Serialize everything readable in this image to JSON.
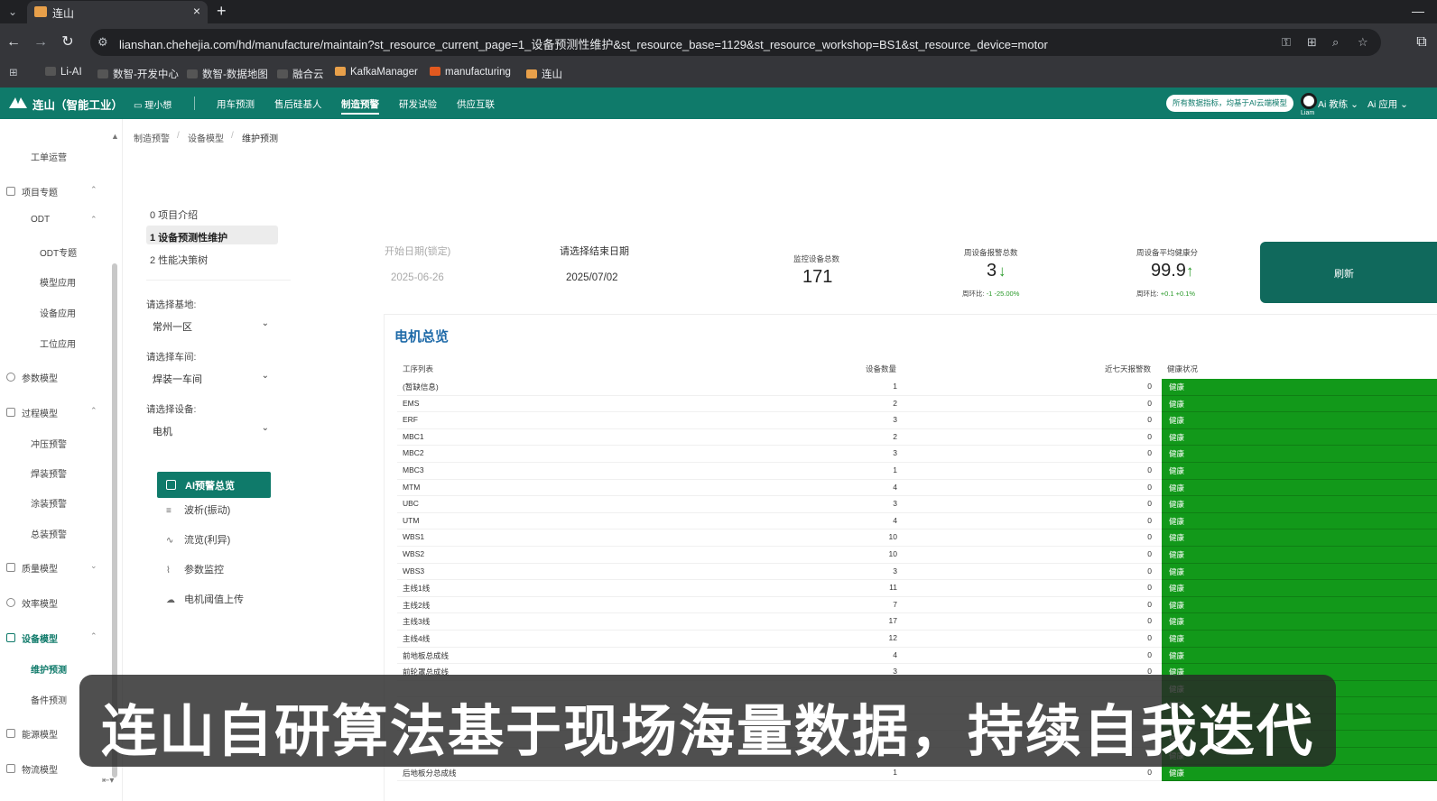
{
  "browser": {
    "tab_title": "连山",
    "url": "lianshan.chehejia.com/hd/manufacture/maintain?st_resource_current_page=1_设备预测性维护&st_resource_base=1129&st_resource_workshop=BS1&st_resource_device=motor",
    "bookmarks": [
      "Li-AI",
      "数智-开发中心",
      "数智-数据地图",
      "融合云",
      "KafkaManager",
      "manufacturing",
      "连山"
    ]
  },
  "app": {
    "name": "连山（智能工业）",
    "mini_program": "理小想",
    "nav": [
      "用车预测",
      "售后硅基人",
      "制造预警",
      "研发试验",
      "供应互联"
    ],
    "active_nav": "制造预警",
    "banner": "所有数据指标，均基于AI云端模型",
    "avatar_label": "Liam",
    "menus": [
      "Ai 教练",
      "Ai 应用"
    ]
  },
  "sidebar": {
    "items": [
      {
        "label": "工单运营"
      },
      {
        "label": "项目专题"
      },
      {
        "label": "ODT"
      },
      {
        "label": "ODT专题"
      },
      {
        "label": "模型应用"
      },
      {
        "label": "设备应用"
      },
      {
        "label": "工位应用"
      },
      {
        "label": "参数模型"
      },
      {
        "label": "过程模型"
      },
      {
        "label": "冲压预警"
      },
      {
        "label": "焊装预警"
      },
      {
        "label": "涂装预警"
      },
      {
        "label": "总装预警"
      },
      {
        "label": "质量模型"
      },
      {
        "label": "效率模型"
      },
      {
        "label": "设备模型"
      },
      {
        "label": "维护预测"
      },
      {
        "label": "备件预测"
      },
      {
        "label": "能源模型"
      },
      {
        "label": "物流模型"
      }
    ]
  },
  "breadcrumb": [
    "制造预警",
    "设备模型",
    "维护预测"
  ],
  "subnav": [
    "0 项目介绍",
    "1 设备预测性维护",
    "2 性能决策树"
  ],
  "filters": {
    "base_label": "请选择基地:",
    "base_value": "常州一区",
    "workshop_label": "请选择车间:",
    "workshop_value": "焊装一车间",
    "device_label": "请选择设备:",
    "device_value": "电机"
  },
  "menu": {
    "active": "AI预警总览",
    "items": [
      "波析(振动)",
      "流览(利异)",
      "参数监控",
      "电机阈值上传"
    ]
  },
  "dates": {
    "start_label": "开始日期(锁定)",
    "start_value": "2025-06-26",
    "end_label": "请选择结束日期",
    "end_value": "2025/07/02"
  },
  "stats": {
    "monitored_label": "监控设备总数",
    "monitored_value": "171",
    "alarm_label": "周设备报警总数",
    "alarm_value": "3",
    "alarm_sub_label": "周环比:",
    "alarm_sub_value": "-1 -25.00%",
    "health_label": "周设备平均健康分",
    "health_value": "99.9",
    "health_sub_label": "周环比:",
    "health_sub_value": "+0.1 +0.1%",
    "refresh_label": "刷新"
  },
  "overview": {
    "title": "电机总览",
    "columns": [
      "工序列表",
      "设备数量",
      "近七天报警数",
      "健康状况"
    ],
    "rows": [
      {
        "name": "(暂缺信息)",
        "count": "1",
        "alarms": "0",
        "health": "健康"
      },
      {
        "name": "EMS",
        "count": "2",
        "alarms": "0",
        "health": "健康"
      },
      {
        "name": "ERF",
        "count": "3",
        "alarms": "0",
        "health": "健康"
      },
      {
        "name": "MBC1",
        "count": "2",
        "alarms": "0",
        "health": "健康"
      },
      {
        "name": "MBC2",
        "count": "3",
        "alarms": "0",
        "health": "健康"
      },
      {
        "name": "MBC3",
        "count": "1",
        "alarms": "0",
        "health": "健康"
      },
      {
        "name": "MTM",
        "count": "4",
        "alarms": "0",
        "health": "健康"
      },
      {
        "name": "UBC",
        "count": "3",
        "alarms": "0",
        "health": "健康"
      },
      {
        "name": "UTM",
        "count": "4",
        "alarms": "0",
        "health": "健康"
      },
      {
        "name": "WBS1",
        "count": "10",
        "alarms": "0",
        "health": "健康"
      },
      {
        "name": "WBS2",
        "count": "10",
        "alarms": "0",
        "health": "健康"
      },
      {
        "name": "WBS3",
        "count": "3",
        "alarms": "0",
        "health": "健康"
      },
      {
        "name": "主线1线",
        "count": "11",
        "alarms": "0",
        "health": "健康"
      },
      {
        "name": "主线2线",
        "count": "7",
        "alarms": "0",
        "health": "健康"
      },
      {
        "name": "主线3线",
        "count": "17",
        "alarms": "0",
        "health": "健康"
      },
      {
        "name": "主线4线",
        "count": "12",
        "alarms": "0",
        "health": "健康"
      },
      {
        "name": "前地板总成线",
        "count": "4",
        "alarms": "0",
        "health": "健康"
      },
      {
        "name": "前轮罩总成线",
        "count": "3",
        "alarms": "0",
        "health": "健康"
      },
      {
        "name": "",
        "count": "",
        "alarms": "",
        "health": "健康"
      },
      {
        "name": "",
        "count": "",
        "alarms": "",
        "health": "健康"
      },
      {
        "name": "",
        "count": "",
        "alarms": "",
        "health": "健康"
      },
      {
        "name": "",
        "count": "",
        "alarms": "",
        "health": "健康"
      },
      {
        "name": "",
        "count": "",
        "alarms": "",
        "health": "健康"
      },
      {
        "name": "后地板分总成线",
        "count": "1",
        "alarms": "0",
        "health": "健康"
      }
    ]
  },
  "subtitle": "连山自研算法基于现场海量数据，持续自我迭代",
  "colors": {
    "brand": "#0f7a6a",
    "healthy": "#12991a",
    "title_blue": "#1e6aa8",
    "trend_green": "#2a9a2a"
  }
}
